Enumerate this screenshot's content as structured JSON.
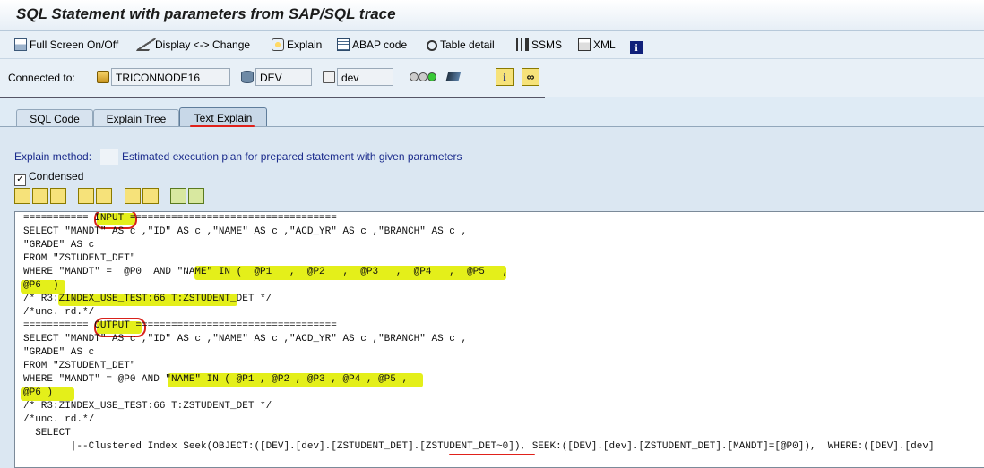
{
  "window": {
    "title": "SQL Statement with parameters from SAP/SQL trace"
  },
  "toolbar": {
    "full_screen": "Full Screen On/Off",
    "display_change": "Display <-> Change",
    "explain": "Explain",
    "abap_code": "ABAP code",
    "table_detail": "Table detail",
    "ssms": "SSMS",
    "xml": "XML"
  },
  "connection": {
    "label": "Connected to:",
    "server": "TRICONNODE16",
    "database": "DEV",
    "schema": "dev"
  },
  "tabs": [
    "SQL Code",
    "Explain Tree",
    "Text Explain"
  ],
  "active_tab": "Text Explain",
  "explain": {
    "method_label": "Explain method:",
    "method_value": "Estimated execution plan for prepared statement with given parameters",
    "condensed_label": "Condensed",
    "condensed_checked": true
  },
  "code_lines": [
    "=========== INPUT ===================================",
    "SELECT \"MANDT\" AS c ,\"ID\" AS c ,\"NAME\" AS c ,\"ACD_YR\" AS c ,\"BRANCH\" AS c ,",
    "\"GRADE\" AS c",
    "FROM \"ZSTUDENT_DET\"",
    "WHERE \"MANDT\" =  @P0  AND \"NAME\" IN (  @P1   ,  @P2   ,  @P3   ,  @P4   ,  @P5   ,",
    "@P6  )",
    "/* R3:ZINDEX_USE_TEST:66 T:ZSTUDENT_DET */",
    "/*unc. rd.*/",
    "=========== OUTPUT ==================================",
    "SELECT \"MANDT\" AS c ,\"ID\" AS c ,\"NAME\" AS c ,\"ACD_YR\" AS c ,\"BRANCH\" AS c ,",
    "\"GRADE\" AS c",
    "FROM \"ZSTUDENT_DET\"",
    "WHERE \"MANDT\" = @P0 AND \"NAME\" IN ( @P1 , @P2 , @P3 , @P4 , @P5 ,",
    "@P6 )",
    "/* R3:ZINDEX_USE_TEST:66 T:ZSTUDENT_DET */",
    "/*unc. rd.*/",
    "  SELECT",
    "        |--Clustered Index Seek(OBJECT:([DEV].[dev].[ZSTUDENT_DET].[ZSTUDENT_DET~0]), SEEK:([DEV].[dev].[ZSTUDENT_DET].[MANDT]=[@P0]),  WHERE:([DEV].[dev]"
  ],
  "colors": {
    "highlight": "#e4ef1a",
    "annotation_red": "#d8211a",
    "label_blue": "#1a2b8c"
  },
  "icons": [
    "page-icon",
    "pen-icon",
    "explain-icon",
    "abap-icon",
    "magnifier-icon",
    "ssms-icon",
    "xml-icon",
    "info-icon"
  ]
}
